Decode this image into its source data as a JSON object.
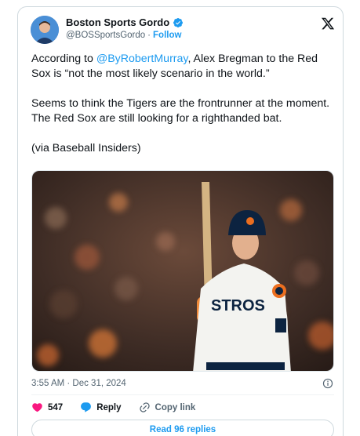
{
  "author": {
    "display_name": "Boston Sports Gordo",
    "handle": "@BOSSportsGordo",
    "separator": "·",
    "follow_label": "Follow",
    "avatar_icon": "avatar-photo",
    "verified_icon": "verified-badge-icon"
  },
  "tweet": {
    "line1_prefix": "According to ",
    "mention": "@ByRobertMurray",
    "line1_suffix": ", Alex Bregman to the Red Sox is “not the most likely scenario in the world.”",
    "paragraph2": "Seems to think the Tigers are the frontrunner at the moment. The Red Sox are still looking for a righthanded bat.",
    "paragraph3": "(via Baseball Insiders)",
    "timestamp": "3:55 AM · Dec 31, 2024"
  },
  "actions": {
    "like_count": "547",
    "reply_label": "Reply",
    "copy_label": "Copy link"
  },
  "read_replies_label": "Read 96 replies",
  "colors": {
    "accent": "#1d9bf0",
    "like": "#f91880",
    "muted": "#536471"
  }
}
